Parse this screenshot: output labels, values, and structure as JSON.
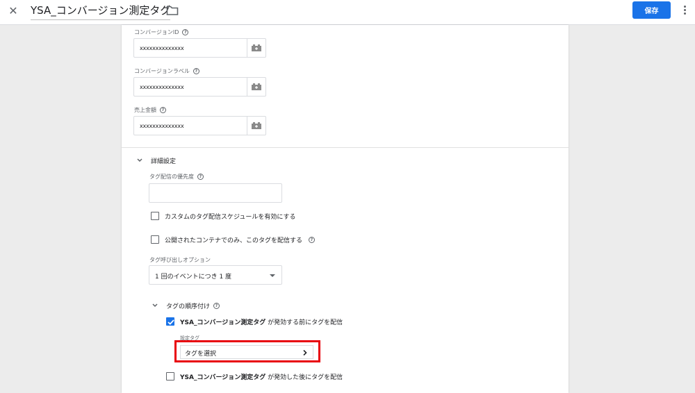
{
  "header": {
    "title": "YSA_コンバージョン測定タグ",
    "save_label": "保存"
  },
  "fields": [
    {
      "label": "コンバージョンID",
      "value": "xxxxxxxxxxxxxx"
    },
    {
      "label": "コンバージョンラベル",
      "value": "xxxxxxxxxxxxxx"
    },
    {
      "label": "売上金額",
      "value": "xxxxxxxxxxxxxx"
    }
  ],
  "advanced": {
    "title": "詳細設定",
    "priority_label": "タグ配信の優先度",
    "priority_value": "",
    "custom_schedule_label": "カスタムのタグ配信スケジュールを有効にする",
    "published_only_label": "公開されたコンテナでのみ、このタグを配信する",
    "firing_option_label": "タグ呼び出しオプション",
    "firing_option_value": "1 回のイベントにつき 1 度",
    "sequencing": {
      "title": "タグの順序付け",
      "setup_tag_name": "YSA_コンバージョン測定タグ",
      "setup_tag_suffix": " が発効する前にタグを配信",
      "setup_tag_checked": true,
      "setup_tag_label": "設定タグ",
      "select_tag_label": "タグを選択",
      "cleanup_tag_name": "YSA_コンバージョン測定タグ",
      "cleanup_tag_suffix": " が発効した後にタグを配信",
      "cleanup_tag_checked": false
    }
  },
  "colors": {
    "accent": "#1a73e8",
    "highlight": "#e8000b"
  },
  "icons": [
    "close-icon",
    "folder-icon",
    "more-vert-icon",
    "variable-brick-icon",
    "chevron-down-icon",
    "help-icon",
    "check-icon",
    "chevron-right-icon"
  ]
}
